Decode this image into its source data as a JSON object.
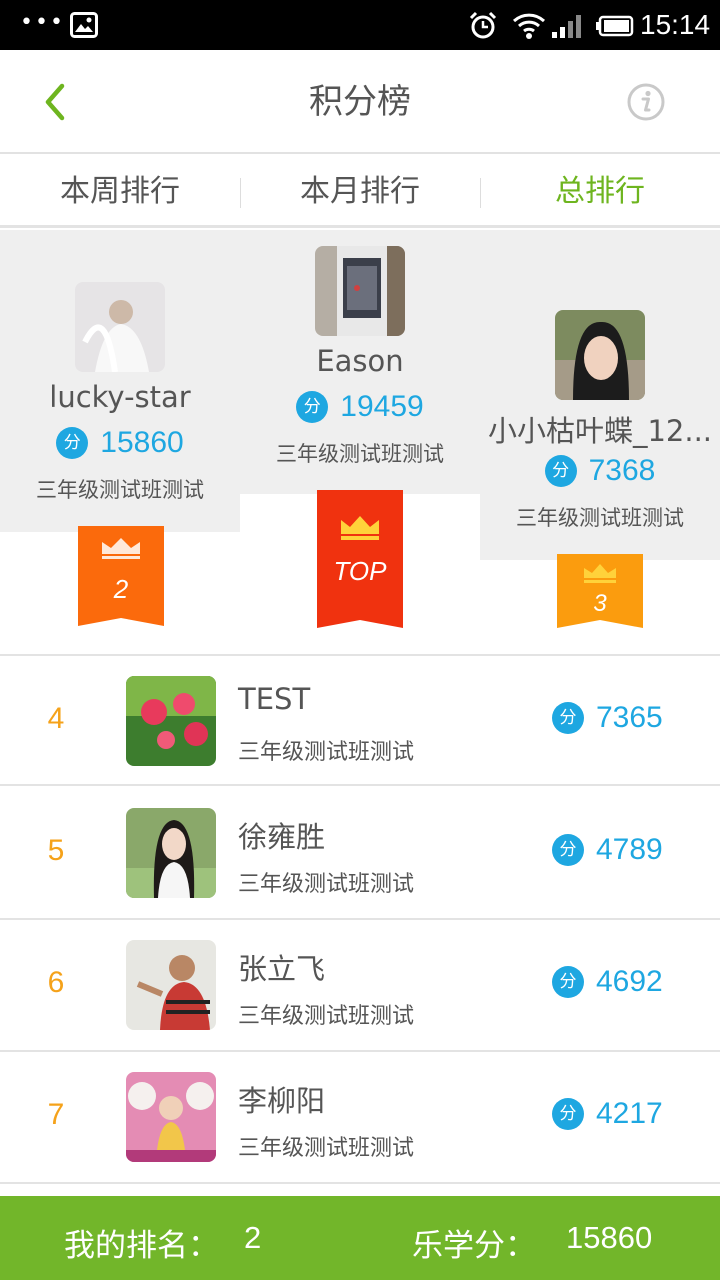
{
  "status_bar": {
    "time": "15:14",
    "more_dots": "•••"
  },
  "header": {
    "title": "积分榜",
    "back_icon": "chevron-left-icon",
    "info_icon": "info-icon"
  },
  "tabs": [
    {
      "label": "本周排行",
      "active": false
    },
    {
      "label": "本月排行",
      "active": false
    },
    {
      "label": "总排行",
      "active": true
    }
  ],
  "podium": {
    "score_badge": "分",
    "first": {
      "name": "Eason",
      "score": "19459",
      "class": "三年级测试班测试",
      "ribbon": "TOP"
    },
    "second": {
      "name": "lucky-star",
      "score": "15860",
      "class": "三年级测试班测试",
      "ribbon": "2"
    },
    "third": {
      "name": "小小枯叶蝶_12...",
      "score": "7368",
      "class": "三年级测试班测试",
      "ribbon": "3"
    }
  },
  "list": [
    {
      "rank": "4",
      "name": "TEST",
      "class": "三年级测试班测试",
      "score": "7365"
    },
    {
      "rank": "5",
      "name": "徐雍胜",
      "class": "三年级测试班测试",
      "score": "4789"
    },
    {
      "rank": "6",
      "name": "张立飞",
      "class": "三年级测试班测试",
      "score": "4692"
    },
    {
      "rank": "7",
      "name": "李柳阳",
      "class": "三年级测试班测试",
      "score": "4217"
    }
  ],
  "footer": {
    "rank_label": "我的排名：",
    "rank_value": "2",
    "points_label": "乐学分：",
    "points_value": "15860"
  },
  "colors": {
    "accent_green": "#6eb51f",
    "score_blue": "#1ea7e1",
    "rank_orange": "#f5a21a",
    "ribbon_top": "#f0320f",
    "ribbon_second": "#fb6a0c",
    "ribbon_third": "#fb9c0e"
  }
}
